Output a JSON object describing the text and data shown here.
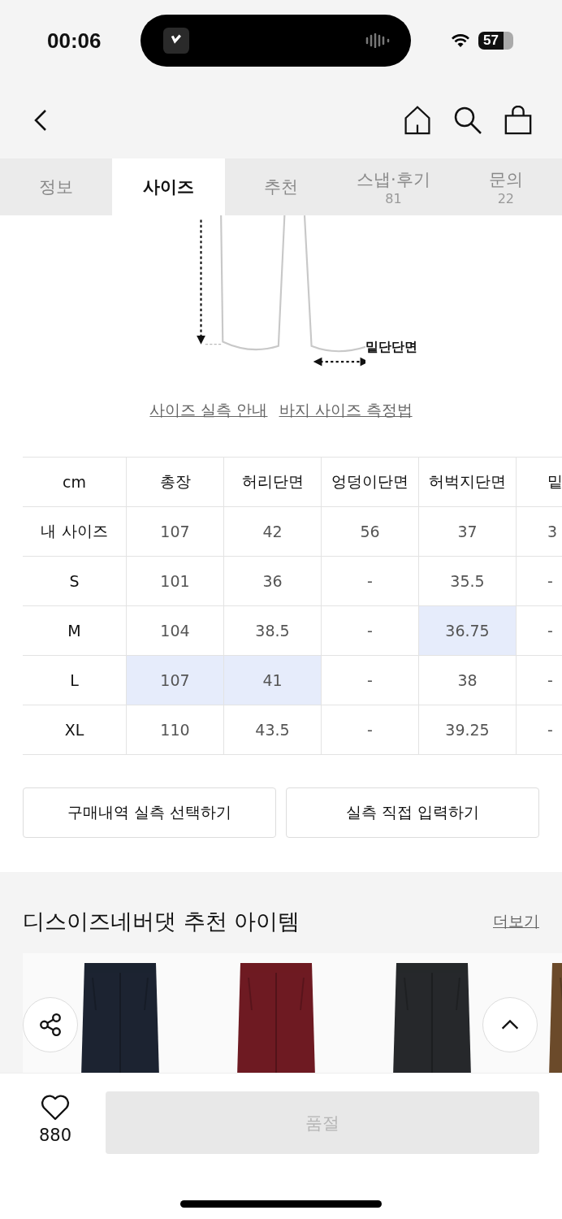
{
  "status_bar": {
    "time": "00:06",
    "battery": "57"
  },
  "tabs": [
    {
      "label": "정보",
      "selected": false
    },
    {
      "label": "사이즈",
      "selected": true
    },
    {
      "label": "추천",
      "selected": false
    },
    {
      "label": "스냅·후기",
      "count": "81",
      "selected": false
    },
    {
      "label": "문의",
      "count": "22",
      "selected": false
    }
  ],
  "diagram": {
    "label": "밑단단면"
  },
  "size_links": [
    "사이즈 실측 안내",
    "바지 사이즈 측정법"
  ],
  "size_table": {
    "columns": [
      "cm",
      "총장",
      "허리단면",
      "엉덩이단면",
      "허벅지단면",
      "밑"
    ],
    "rows": [
      {
        "cells": [
          {
            "text": "내 사이즈",
            "highlighted": false
          },
          {
            "text": "107",
            "highlighted": false
          },
          {
            "text": "42",
            "highlighted": false
          },
          {
            "text": "56",
            "highlighted": false
          },
          {
            "text": "37",
            "highlighted": false
          },
          {
            "text": "3",
            "highlighted": false
          }
        ]
      },
      {
        "cells": [
          {
            "text": "S",
            "highlighted": false
          },
          {
            "text": "101",
            "highlighted": false
          },
          {
            "text": "36",
            "highlighted": false
          },
          {
            "text": "-",
            "highlighted": false
          },
          {
            "text": "35.5",
            "highlighted": false
          },
          {
            "text": "-",
            "highlighted": false
          }
        ]
      },
      {
        "cells": [
          {
            "text": "M",
            "highlighted": false
          },
          {
            "text": "104",
            "highlighted": false
          },
          {
            "text": "38.5",
            "highlighted": false
          },
          {
            "text": "-",
            "highlighted": false
          },
          {
            "text": "36.75",
            "highlighted": true
          },
          {
            "text": "-",
            "highlighted": false
          }
        ]
      },
      {
        "cells": [
          {
            "text": "L",
            "highlighted": false
          },
          {
            "text": "107",
            "highlighted": true
          },
          {
            "text": "41",
            "highlighted": true
          },
          {
            "text": "-",
            "highlighted": false
          },
          {
            "text": "38",
            "highlighted": false
          },
          {
            "text": "-",
            "highlighted": false
          }
        ]
      },
      {
        "cells": [
          {
            "text": "XL",
            "highlighted": false
          },
          {
            "text": "110",
            "highlighted": false
          },
          {
            "text": "43.5",
            "highlighted": false
          },
          {
            "text": "-",
            "highlighted": false
          },
          {
            "text": "39.25",
            "highlighted": false
          },
          {
            "text": "-",
            "highlighted": false
          }
        ]
      }
    ]
  },
  "size_buttons": [
    "구매내역 실측 선택하기",
    "실측 직접 입력하기"
  ],
  "recommend": {
    "title": "디스이즈네버댓 추천 아이템",
    "more": "더보기"
  },
  "bottom_bar": {
    "likes": "880",
    "buy_button": {
      "label": "품절",
      "disabled": true
    }
  }
}
